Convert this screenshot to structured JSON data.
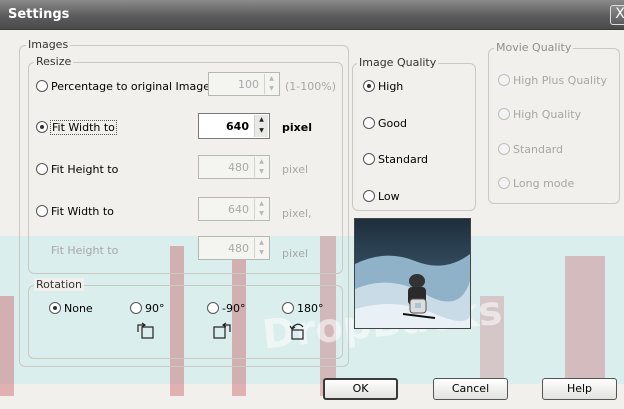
{
  "window": {
    "title": "Settings",
    "close_label": "X"
  },
  "images": {
    "legend": "Images",
    "resize": {
      "legend": "Resize",
      "percentage_label": "Percentage to original Images",
      "percentage_value": "100",
      "percentage_range": "(1-100%)",
      "fit_width_label": "Fit Width to",
      "fit_width_value": "640",
      "fit_width_unit": "pixel",
      "fit_height_label": "Fit Height to",
      "fit_height_value": "480",
      "fit_height_unit": "pixel",
      "fit_both_width_label": "Fit Width to",
      "fit_both_width_value": "640",
      "fit_both_width_unit": "pixel,",
      "fit_both_height_label": "Fit Height to",
      "fit_both_height_value": "480",
      "fit_both_height_unit": "pixel",
      "selected": "fit_width"
    },
    "rotation": {
      "legend": "Rotation",
      "none_label": "None",
      "r90_label": "90°",
      "rm90_label": "-90°",
      "r180_label": "180°",
      "selected": "none"
    }
  },
  "image_quality": {
    "legend": "Image Quality",
    "high_label": "High",
    "good_label": "Good",
    "standard_label": "Standard",
    "low_label": "Low",
    "selected": "high"
  },
  "movie_quality": {
    "legend": "Movie Quality",
    "high_plus_label": "High Plus Quality",
    "high_label": "High Quality",
    "standard_label": "Standard",
    "long_label": "Long mode"
  },
  "buttons": {
    "ok_label": "OK",
    "cancel_label": "Cancel",
    "help_label": "Help"
  },
  "watermark": {
    "text": "DropBacks"
  },
  "colors": {
    "title_bar": "#5c5c5c",
    "watermark_band": "#c6ecef",
    "watermark_accent": "#c23b45"
  }
}
